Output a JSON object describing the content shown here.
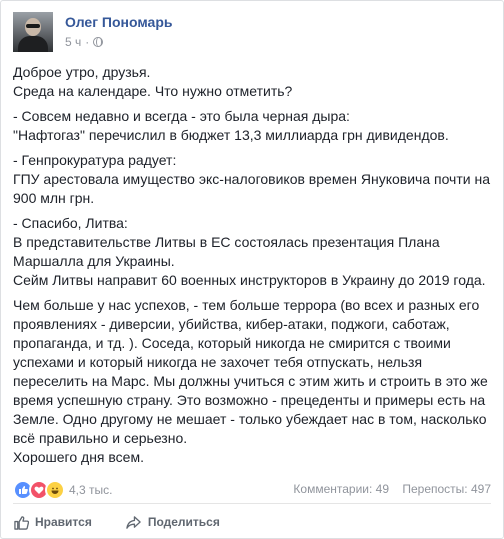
{
  "post": {
    "author": "Олег Пономарь",
    "time": "5 ч",
    "paragraphs": [
      "Доброе утро, друзья.\nСреда на календаре. Что нужно отметить?",
      "- Совсем недавно и всегда - это была черная дыра:\n\"Нафтогаз\" перечислил в бюджет 13,3 миллиарда грн дивидендов.",
      "- Генпрокуратура радует:\nГПУ арестовала имущество экс-налоговиков времен Януковича почти на 900 млн грн.",
      "- Спасибо, Литва:\nВ представительстве Литвы в ЕС состоялась презентация Плана Маршалла для Украины.\nСейм Литвы направит 60 военных инструкторов в Украину до 2019 года.",
      "Чем больше у нас успехов, - тем больше террора (во всех и разных его проявлениях - диверсии, убийства, кибер-атаки, поджоги, саботаж, пропаганда, и тд. ). Соседа, который никогда не смирится с твоими успехами и который никогда не захочет тебя отпускать, нельзя переселить на Марс. Мы должны учиться с этим жить и строить в это же время успешную страну. Это возможно - прецеденты и примеры есть на Земле. Одно другому не мешает - только убеждает нас в том, насколько всё правильно и серьезно.\nХорошего дня всем."
    ]
  },
  "stats": {
    "reaction_count": "4,3 тыс.",
    "comments": "Комментарии: 49",
    "shares": "Перепосты: 497",
    "reaction_icons": [
      "like-reaction-icon",
      "love-reaction-icon",
      "haha-reaction-icon"
    ]
  },
  "actions": {
    "like_label": "Нравится",
    "share_label": "Поделиться"
  },
  "colors": {
    "link": "#365899",
    "meta": "#90949c",
    "like": "#5890ff",
    "love": "#f25268",
    "haha": "#fcd144"
  }
}
